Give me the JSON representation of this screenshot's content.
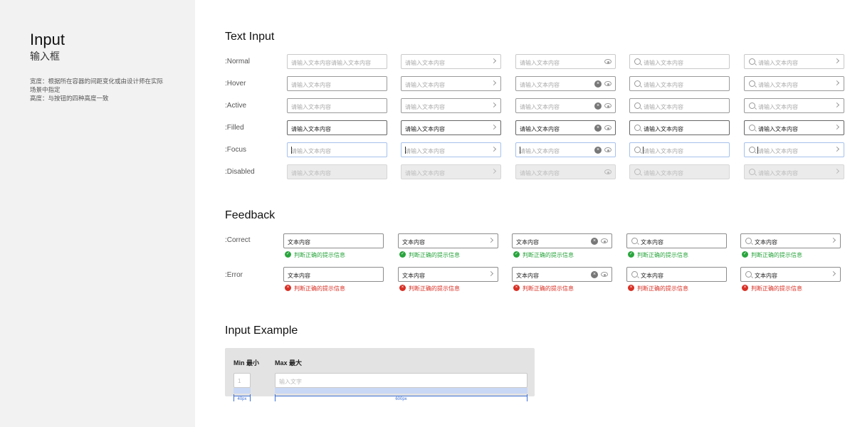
{
  "sidebar": {
    "title": "Input",
    "subtitle": "输入框",
    "desc_width": "宽度：根据所在容器的间距变化或由设计师在实际\n场景中指定",
    "desc_height": "高度：与按钮的四种高度一致"
  },
  "text_input": {
    "title": "Text Input",
    "states": [
      {
        "label": ":Normal",
        "values": [
          "请输入文本内容请输入文本内容",
          "请输入文本内容",
          "请输入文本内容",
          "请输入文本内容",
          "请输入文本内容"
        ]
      },
      {
        "label": ":Hover",
        "values": [
          "请输入文本内容",
          "请输入文本内容",
          "请输入文本内容",
          "请输入文本内容",
          "请输入文本内容"
        ]
      },
      {
        "label": ":Active",
        "values": [
          "请输入文本内容",
          "请输入文本内容",
          "请输入文本内容",
          "请输入文本内容",
          "请输入文本内容"
        ]
      },
      {
        "label": ":Filled",
        "values": [
          "请输入文本内容",
          "请输入文本内容",
          "请输入文本内容",
          "请输入文本内容",
          "请输入文本内容"
        ]
      },
      {
        "label": ":Focus",
        "values": [
          "请输入文本内容",
          "请输入文本内容",
          "请输入文本内容",
          "请输入文本内容",
          "请输入文本内容"
        ]
      },
      {
        "label": ":Disabled",
        "values": [
          "请输入文本内容",
          "请输入文本内容",
          "请输入文本内容",
          "请输入文本内容",
          "请输入文本内容"
        ]
      }
    ]
  },
  "feedback": {
    "title": "Feedback",
    "correct_label": ":Correct",
    "error_label": ":Error",
    "value": "文本内容",
    "message": "判断正确的提示信息",
    "ok_color": "#2aa53e",
    "err_color": "#d93025"
  },
  "example": {
    "title": "Input Example",
    "min_label": "Min 最小",
    "max_label": "Max 最大",
    "min_value": "1",
    "max_placeholder": "输入文字",
    "min_dim": "40px",
    "max_dim": "600px",
    "dim_color": "#3b6fd4"
  },
  "icons": {
    "search": "search-icon",
    "chevron": "chevron-right-icon",
    "eye": "eye-icon",
    "clear": "clear-icon",
    "check": "check-circle-icon",
    "error": "error-circle-icon"
  }
}
